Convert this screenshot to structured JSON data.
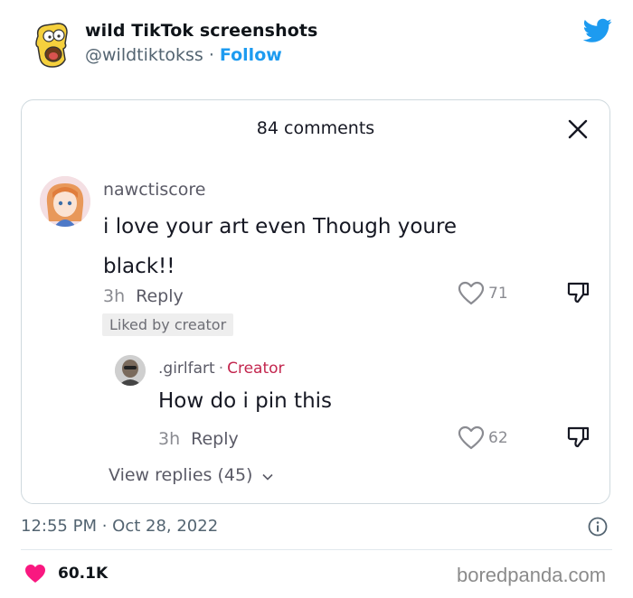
{
  "tweet": {
    "author_name": "wild TikTok screenshots",
    "handle": "@wildtiktokss",
    "separator": "·",
    "follow_label": "Follow",
    "brand_icon": "twitter-bird-icon",
    "brand_color": "#1d9bf0",
    "timestamp": "12:55 PM · Oct 28, 2022",
    "likes": "60.1K",
    "like_color": "#f91880"
  },
  "tiktok": {
    "title": "84 comments",
    "comment": {
      "username": "nawctiscore",
      "text": "i love your art even Though youre black!!",
      "time": "3h",
      "reply_label": "Reply",
      "likes": "71",
      "badge": "Liked by creator"
    },
    "reply": {
      "username": ".girlfart",
      "separator": "·",
      "creator_label": "Creator",
      "creator_color": "#c3264e",
      "text": "How do i pin this",
      "time": "3h",
      "reply_label": "Reply",
      "likes": "62"
    },
    "view_replies": "View replies (45)"
  },
  "watermark": "boredpanda.com"
}
